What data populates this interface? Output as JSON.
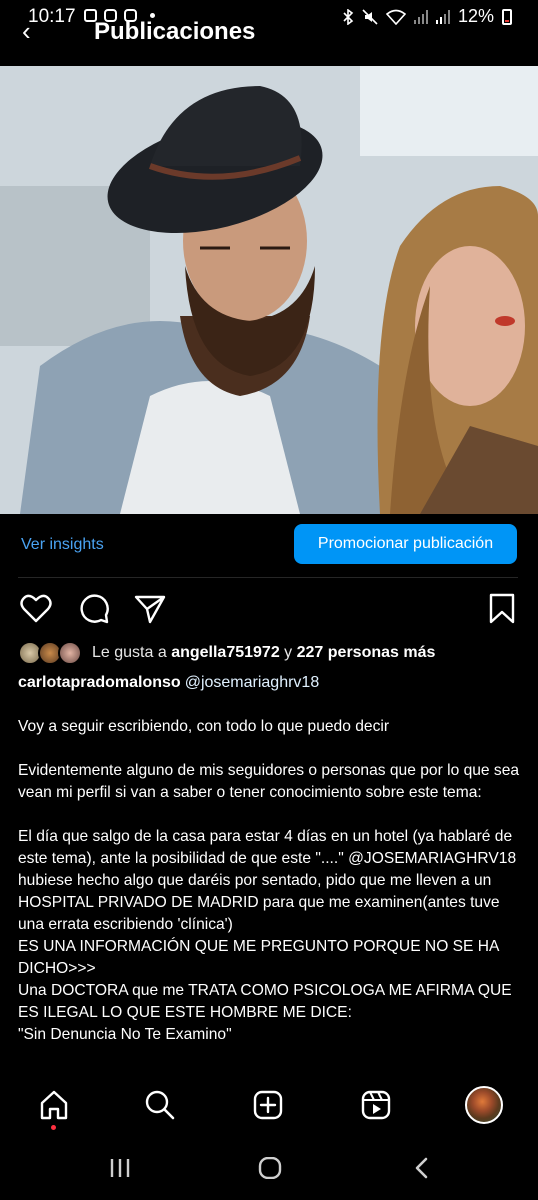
{
  "status_bar": {
    "time": "10:17",
    "battery": "12%",
    "icons": [
      "image-icon",
      "instagram-icon",
      "instagram-icon",
      "dot",
      "bluetooth-icon",
      "mute-icon",
      "wifi-icon",
      "signal-icon",
      "signal-icon",
      "battery-icon"
    ]
  },
  "header": {
    "title": "Publicaciones",
    "back_icon": "chevron-left-icon"
  },
  "post": {
    "insights_label": "Ver insights",
    "promote_label": "Promocionar publicación",
    "actions": [
      "heart-icon",
      "comment-icon",
      "share-icon",
      "bookmark-icon"
    ],
    "likes": {
      "prefix": "Le gusta a",
      "user": "angella751972",
      "connector": "y",
      "others": "227 personas más"
    },
    "author": "carlotapradomalonso",
    "mention": "@josemariaghrv18",
    "caption": [
      "Voy a seguir escribiendo, con todo lo que puedo decir",
      "Evidentemente alguno de mis seguidores o personas que por lo que sea vean mi perfil si van a saber o tener conocimiento sobre este tema:",
      "El día que salgo de la casa para estar 4 días en un hotel (ya hablaré de este tema), ante la posibilidad de que este \"....\" @JOSEMARIAGHRV18 hubiese hecho algo que daréis por sentado, pido que me lleven a un HOSPITAL PRIVADO DE MADRID para que me examinen(antes tuve una errata escribiendo 'clínica')\nES UNA INFORMACIÓN QUE ME PREGUNTO PORQUE NO SE HA DICHO>>>\nUna DOCTORA que me TRATA COMO PSICOLOGA ME AFIRMA QUE ES ILEGAL LO QUE ESTE HOMBRE ME DICE:\n\"Sin Denuncia No Te Examino\""
    ]
  },
  "bottom_nav": [
    "home-icon",
    "search-icon",
    "create-icon",
    "reels-icon",
    "profile-avatar"
  ],
  "system_nav": [
    "recents-icon",
    "home-circle-icon",
    "back-icon"
  ],
  "colors": {
    "accent": "#0095f6",
    "link": "#4aa3f2",
    "background": "#000000"
  }
}
